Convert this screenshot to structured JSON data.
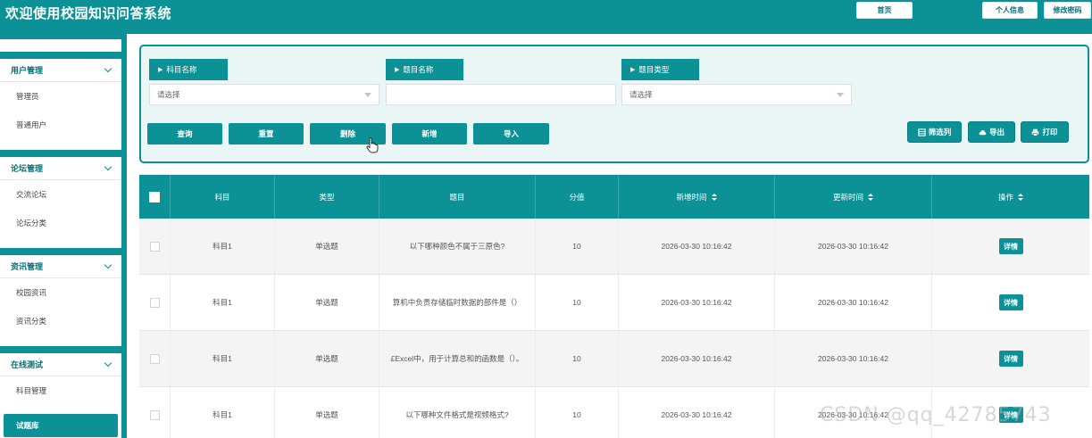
{
  "app": {
    "title": "欢迎使用校园知识问答系统"
  },
  "topnav": {
    "home": "首页",
    "profile": "个人信息",
    "change_password": "修改密码"
  },
  "sidebar": {
    "groups": [
      {
        "title": "用户管理",
        "items": [
          "管理员",
          "普通用户"
        ]
      },
      {
        "title": "论坛管理",
        "items": [
          "交流论坛",
          "论坛分类"
        ]
      },
      {
        "title": "资讯管理",
        "items": [
          "校园资讯",
          "资讯分类"
        ]
      },
      {
        "title": "在线测试",
        "items": [
          "科目管理",
          "试题库"
        ]
      }
    ],
    "active_item": "试题库"
  },
  "search": {
    "subject_label": "科目名称",
    "subject_placeholder": "请选择",
    "question_label": "题目名称",
    "question_value": "",
    "type_label": "题目类型",
    "type_placeholder": "请选择"
  },
  "actions": {
    "query": "查询",
    "reset": "重置",
    "delete": "删除",
    "add": "新增",
    "import": "导入"
  },
  "tools": {
    "filter_columns": "筛选列",
    "export": "导出",
    "print": "打印"
  },
  "table": {
    "columns": [
      "科目",
      "类型",
      "题目",
      "分值",
      "新增时间",
      "更新时间",
      "操作"
    ],
    "rows": [
      {
        "subject": "科目1",
        "type": "单选题",
        "question": "以下哪种颜色不属于三原色?",
        "score": "10",
        "created": "2026-03-30 10:16:42",
        "updated": "2026-03-30 10:16:42",
        "action": "详情"
      },
      {
        "subject": "科目1",
        "type": "单选题",
        "question": "算机中负责存储临时数据的部件是（）",
        "score": "10",
        "created": "2026-03-30 10:16:42",
        "updated": "2026-03-30 10:16:42",
        "action": "详情"
      },
      {
        "subject": "科目1",
        "type": "单选题",
        "question": "£Excel中，用于计算总和的函数是（）。",
        "score": "10",
        "created": "2026-03-30 10:16:42",
        "updated": "2026-03-30 10:16:42",
        "action": "详情"
      },
      {
        "subject": "科目1",
        "type": "单选题",
        "question": "以下哪种文件格式是视频格式?",
        "score": "10",
        "created": "2026-03-30 10:16:42",
        "updated": "2026-03-30 10:16:42",
        "action": "详情"
      }
    ]
  },
  "watermark": "CSDN @qq_42785743",
  "colors": {
    "primary": "#0b9196",
    "panel_bg": "#e9f6f5",
    "row_alt": "#f4f4f4"
  }
}
